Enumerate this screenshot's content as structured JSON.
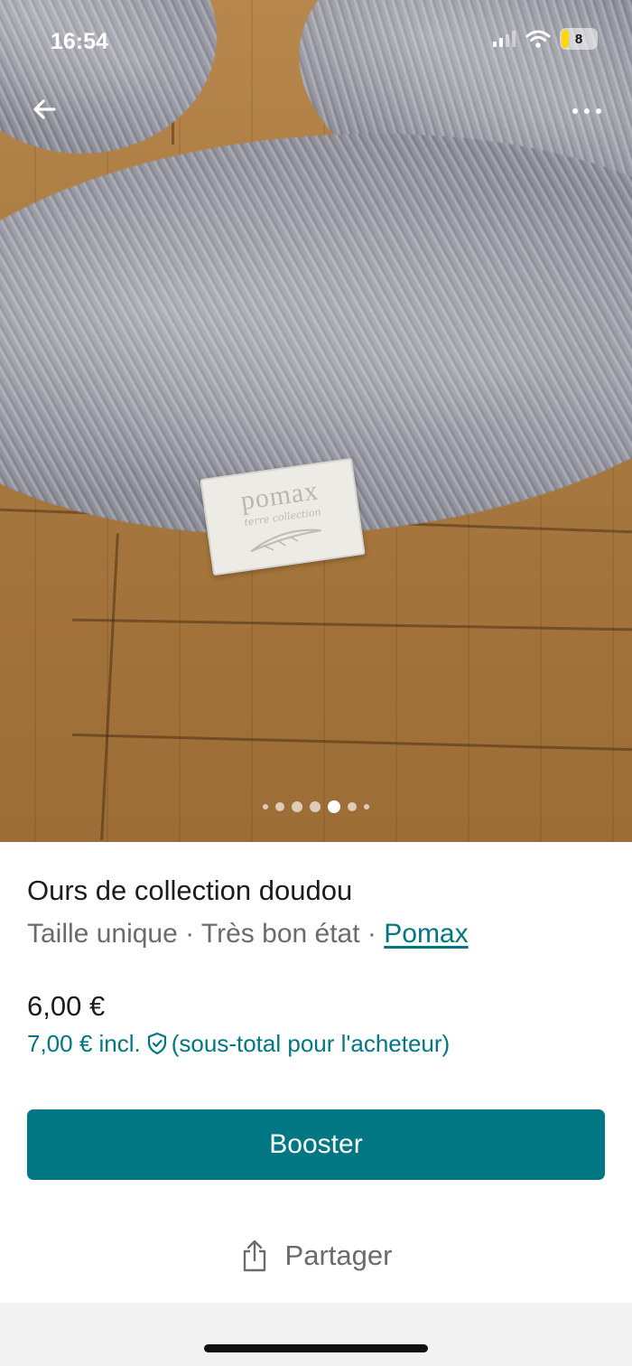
{
  "status_bar": {
    "time": "16:54",
    "battery_level": "8",
    "icons": [
      "signal-icon",
      "wifi-icon",
      "battery-icon"
    ]
  },
  "nav": {
    "back_icon": "arrow-left-icon",
    "more_icon": "ellipsis-icon"
  },
  "gallery": {
    "image_count": 7,
    "active_index": 4,
    "tag_logo": "pomax",
    "tag_subtext": "terre collection"
  },
  "item": {
    "title": "Ours de collection doudou",
    "size": "Taille unique",
    "separator": " · ",
    "condition": "Très bon état",
    "brand": "Pomax"
  },
  "pricing": {
    "price": "6,00 €",
    "price_incl_prefix": "7,00 € incl.",
    "price_incl_suffix": "(sous-total pour l'acheteur)",
    "protection_icon": "shield-check-icon"
  },
  "actions": {
    "booster_label": "Booster",
    "share_label": "Partager",
    "share_icon": "share-icon"
  },
  "colors": {
    "accent": "#007782",
    "text_primary": "#1c1c1c",
    "text_secondary": "#6b6b6b"
  }
}
